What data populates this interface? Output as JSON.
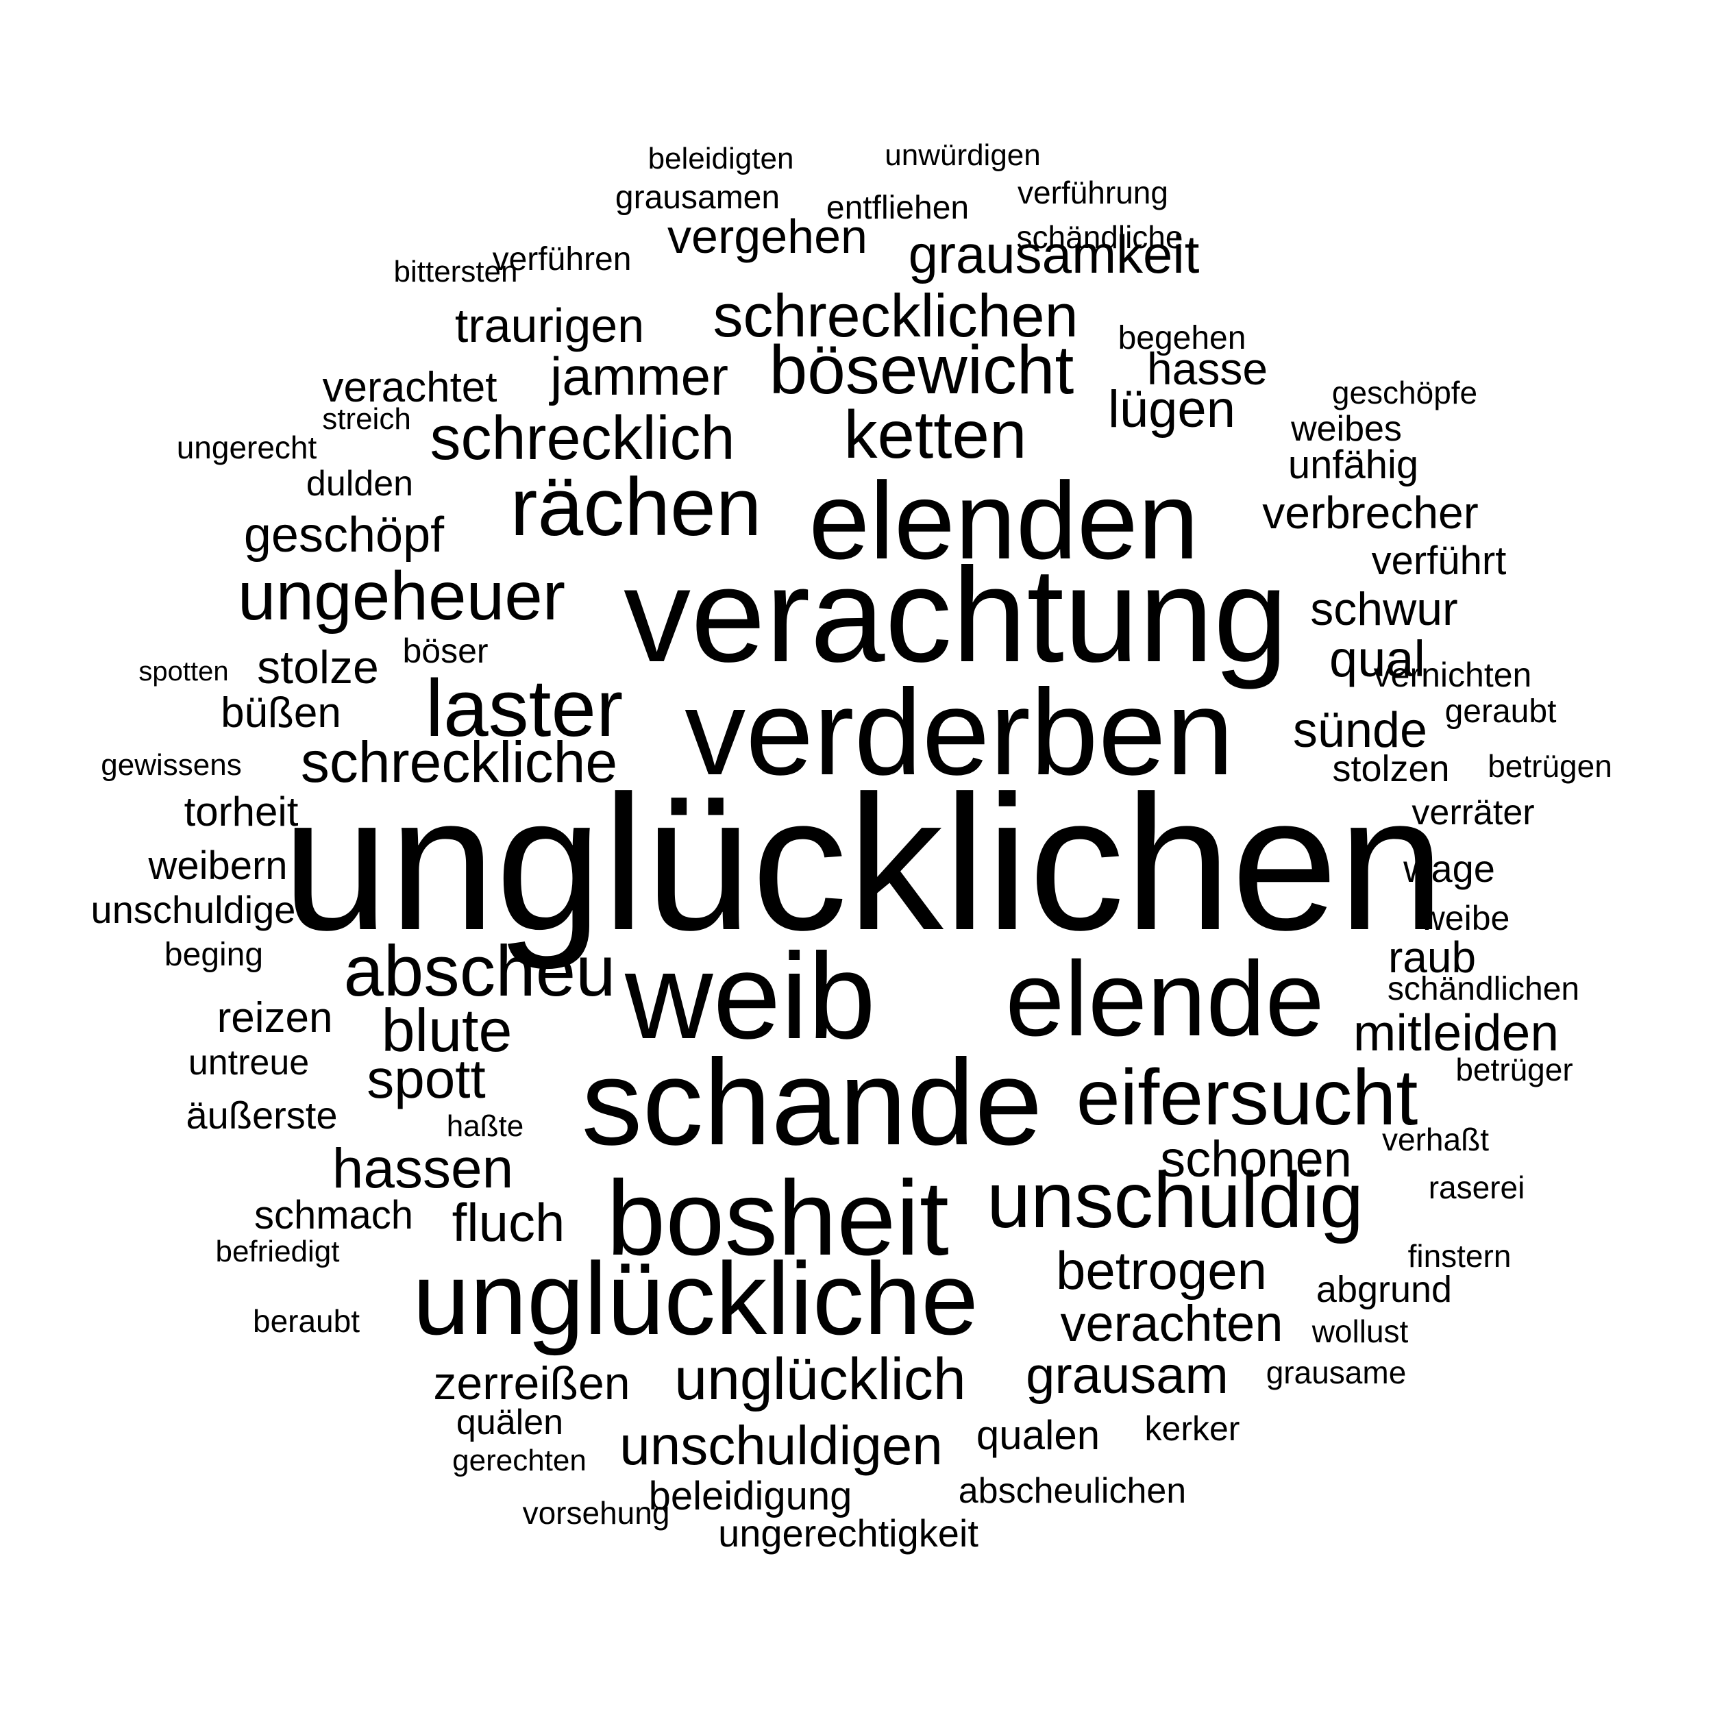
{
  "words": [
    "unglücklichen",
    "verachtung",
    "verderben",
    "weib",
    "schande",
    "elenden",
    "elende",
    "bosheit",
    "unglückliche",
    "rächen",
    "eifersucht",
    "unschuldig",
    "laster",
    "ungeheuer",
    "bösewicht",
    "schrecklichen",
    "abscheu",
    "ketten",
    "schreckliche",
    "schrecklich",
    "unschuldigen",
    "unglücklich",
    "grausamkeit",
    "vergehen",
    "blute",
    "betrogen",
    "verachten",
    "grausam",
    "hassen",
    "mitleiden",
    "schonen",
    "sünde",
    "spott",
    "jammer",
    "zerreißen",
    "traurigen",
    "fluch",
    "lügen",
    "verbrecher",
    "geschöpf",
    "stolze",
    "hasse",
    "schwur",
    "qual",
    "beleidigung",
    "ungerechtigkeit",
    "verachtet",
    "raub",
    "schmach",
    "büßen",
    "qualen",
    "reizen",
    "weibern",
    "unschuldige",
    "torheit",
    "abscheulichen",
    "stolzen",
    "wage",
    "verräter",
    "abgrund",
    "weibe",
    "untreue",
    "äußerste",
    "verführt",
    "unfähig",
    "weibes",
    "geschöpfe",
    "vernichten",
    "geraubt",
    "betrügen",
    "schändlichen",
    "betrüger",
    "verhaßt",
    "raserei",
    "finstern",
    "wollust",
    "grausame",
    "kerker",
    "quälen",
    "gerechten",
    "vorsehung",
    "beraubt",
    "befriedigt",
    "haßte",
    "beging",
    "gewissens",
    "spotten",
    "böser",
    "dulden",
    "ungerecht",
    "streich",
    "bittersten",
    "verführen",
    "grausamen",
    "beleidigten",
    "unwürdigen",
    "verführung",
    "entfliehen",
    "schändliche",
    "begehen"
  ]
}
